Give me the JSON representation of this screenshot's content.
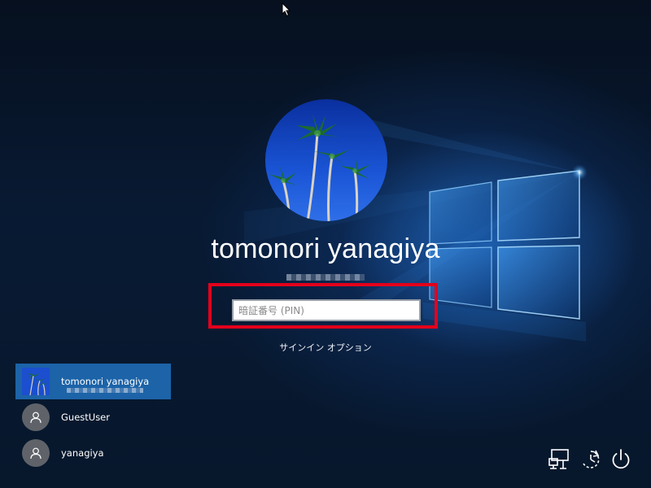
{
  "lock_screen": {
    "user_name": "tomonori yanagiya",
    "pin_placeholder": "暗証番号 (PIN)",
    "pin_value": "",
    "signin_options_label": "サインイン オプション"
  },
  "user_list": [
    {
      "name": "tomonori yanagiya",
      "selected": true,
      "avatar": "palm-tree-photo"
    },
    {
      "name": "GuestUser",
      "selected": false,
      "avatar": "person-icon"
    },
    {
      "name": "yanagiya",
      "selected": false,
      "avatar": "person-icon"
    }
  ],
  "tray_icons": [
    "network-icon",
    "ease-of-access-icon",
    "power-icon"
  ],
  "colors": {
    "highlight_border": "#e4001b",
    "selected_user_bg": "#1c63a8",
    "glow_blue": "#2a8ff0"
  }
}
